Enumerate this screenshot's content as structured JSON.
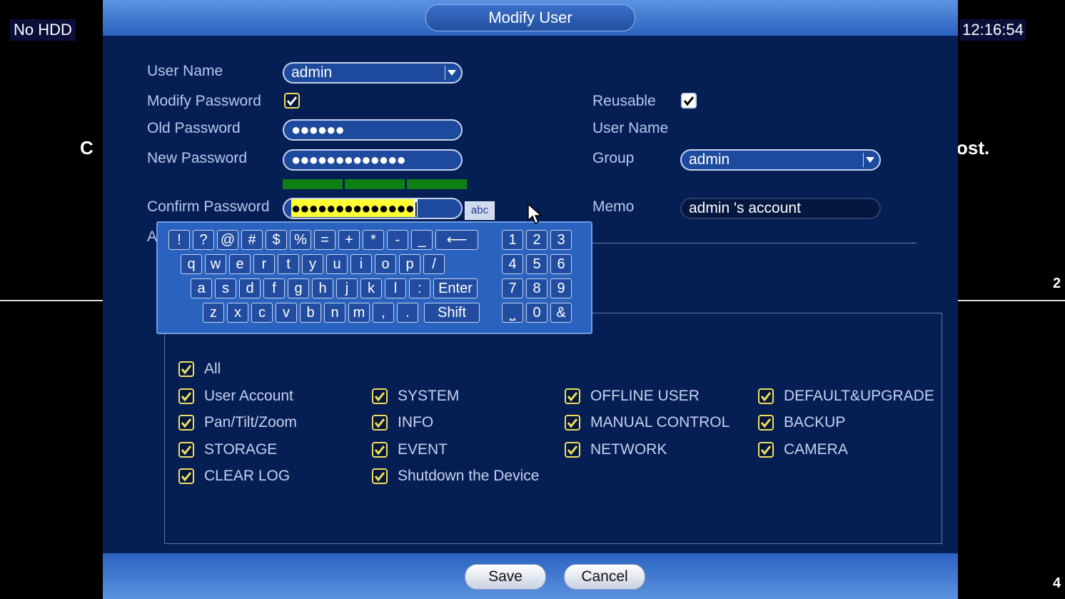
{
  "background": {
    "hdd_status": "No HDD",
    "clock": "12:16:54",
    "text_left": "C",
    "text_right": "ost.",
    "channel_2": "2",
    "channel_4": "4"
  },
  "dialog": {
    "title": "Modify User",
    "left": {
      "user_name_label": "User Name",
      "user_name_value": "admin",
      "modify_password_label": "Modify Password",
      "modify_password_checked": true,
      "old_password_label": "Old Password",
      "old_password_value": "●●●●●●",
      "new_password_label": "New Password",
      "new_password_value": "●●●●●●●●●●●●●",
      "confirm_password_label": "Confirm Password",
      "confirm_password_value": "●●●●●●●●●●●●●●",
      "input_mode": "abc",
      "auth_label_partial": "A"
    },
    "right": {
      "reusable_label": "Reusable",
      "reusable_checked": true,
      "user_name_label": "User Name",
      "group_label": "Group",
      "group_value": "admin",
      "memo_label": "Memo",
      "memo_value": "admin 's account"
    },
    "keyboard": {
      "row1": [
        "!",
        "?",
        "@",
        "#",
        "$",
        "%",
        "=",
        "+",
        "*",
        "-",
        "_"
      ],
      "backspace": "⟵",
      "row2": [
        "q",
        "w",
        "e",
        "r",
        "t",
        "y",
        "u",
        "i",
        "o",
        "p",
        "/"
      ],
      "row3": [
        "a",
        "s",
        "d",
        "f",
        "g",
        "h",
        "j",
        "k",
        "l",
        ":"
      ],
      "enter": "Enter",
      "row4": [
        "z",
        "x",
        "c",
        "v",
        "b",
        "n",
        "m",
        ",",
        "."
      ],
      "shift": "Shift",
      "numpad": [
        "1",
        "2",
        "3",
        "4",
        "5",
        "6",
        "7",
        "8",
        "9",
        "⎵",
        "0",
        "&"
      ]
    },
    "authorities": {
      "all": "All",
      "columns": [
        [
          "User Account",
          "Pan/Tilt/Zoom",
          "STORAGE",
          "CLEAR LOG"
        ],
        [
          "SYSTEM",
          "INFO",
          "EVENT",
          "Shutdown the Device"
        ],
        [
          "OFFLINE USER",
          "MANUAL CONTROL",
          "NETWORK"
        ],
        [
          "DEFAULT&UPGRADE",
          "BACKUP",
          "CAMERA"
        ]
      ]
    },
    "buttons": {
      "save": "Save",
      "cancel": "Cancel"
    },
    "colors": {
      "dialog_bg": "#051e54",
      "title_bar": "#2b62bf",
      "strength_bar": "#0e7f12",
      "checkbox_border_yellow": "#f0e060",
      "confirm_highlight": "#ffff33"
    }
  }
}
